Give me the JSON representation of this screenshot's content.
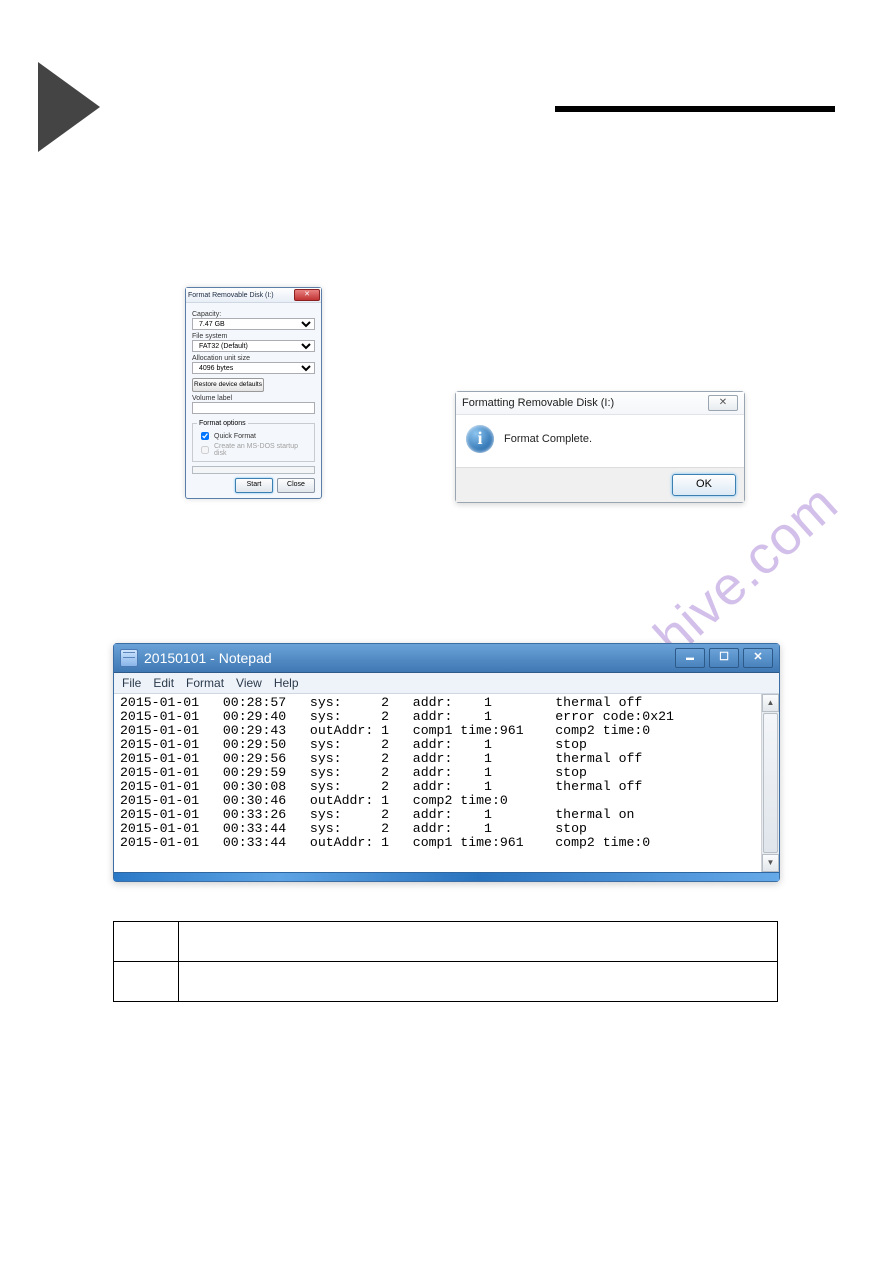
{
  "watermark_text": "manualshive.com",
  "format_dialog": {
    "title": "Format Removable Disk (I:)",
    "close_glyph": "✕",
    "capacity_label": "Capacity:",
    "capacity_value": "7.47 GB",
    "filesystem_label": "File system",
    "filesystem_value": "FAT32 (Default)",
    "alloc_label": "Allocation unit size",
    "alloc_value": "4096 bytes",
    "restore_label": "Restore device defaults",
    "volume_label": "Volume label",
    "volume_value": "",
    "options_legend": "Format options",
    "quick_format_label": "Quick Format",
    "msdos_label": "Create an MS-DOS startup disk",
    "start_label": "Start",
    "close_label": "Close"
  },
  "msgbox": {
    "title": "Formatting Removable Disk (I:)",
    "message": "Format Complete.",
    "ok_label": "OK",
    "close_glyph": "✕"
  },
  "notepad": {
    "title": "20150101 - Notepad",
    "menus": [
      "File",
      "Edit",
      "Format",
      "View",
      "Help"
    ],
    "scroll_up": "▲",
    "scroll_down": "▼",
    "log_rows": [
      {
        "d": "2015-01-01",
        "t": "00:28:57",
        "c1": "sys:",
        "v1": "2",
        "c2": "addr:",
        "v2": "1",
        "msg": "thermal off"
      },
      {
        "d": "2015-01-01",
        "t": "00:29:40",
        "c1": "sys:",
        "v1": "2",
        "c2": "addr:",
        "v2": "1",
        "msg": "error code:0x21"
      },
      {
        "d": "2015-01-01",
        "t": "00:29:43",
        "c1": "outAddr:",
        "v1": "1",
        "c2": "comp1 time:961",
        "v2": "",
        "msg": "comp2 time:0"
      },
      {
        "d": "2015-01-01",
        "t": "00:29:50",
        "c1": "sys:",
        "v1": "2",
        "c2": "addr:",
        "v2": "1",
        "msg": "stop"
      },
      {
        "d": "2015-01-01",
        "t": "00:29:56",
        "c1": "sys:",
        "v1": "2",
        "c2": "addr:",
        "v2": "1",
        "msg": "thermal off"
      },
      {
        "d": "2015-01-01",
        "t": "00:29:59",
        "c1": "sys:",
        "v1": "2",
        "c2": "addr:",
        "v2": "1",
        "msg": "stop"
      },
      {
        "d": "2015-01-01",
        "t": "00:30:08",
        "c1": "sys:",
        "v1": "2",
        "c2": "addr:",
        "v2": "1",
        "msg": "thermal off"
      },
      {
        "d": "2015-01-01",
        "t": "00:30:46",
        "c1": "outAddr:",
        "v1": "1",
        "c2": "comp2 time:0",
        "v2": "",
        "msg": ""
      },
      {
        "d": "2015-01-01",
        "t": "00:33:26",
        "c1": "sys:",
        "v1": "2",
        "c2": "addr:",
        "v2": "1",
        "msg": "thermal on"
      },
      {
        "d": "2015-01-01",
        "t": "00:33:44",
        "c1": "sys:",
        "v1": "2",
        "c2": "addr:",
        "v2": "1",
        "msg": "stop"
      },
      {
        "d": "2015-01-01",
        "t": "00:33:44",
        "c1": "outAddr:",
        "v1": "1",
        "c2": "comp1 time:961",
        "v2": "",
        "msg": "comp2 time:0"
      }
    ]
  }
}
